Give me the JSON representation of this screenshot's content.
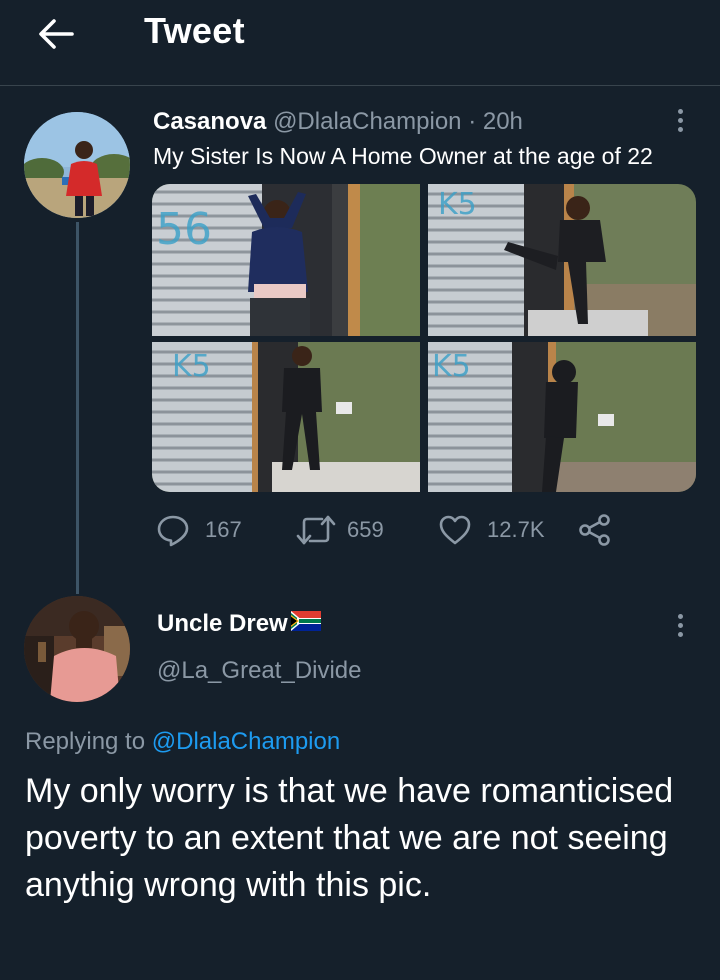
{
  "header": {
    "back_icon": "arrow-left-icon",
    "title": "Tweet"
  },
  "tweet": {
    "author_name": "Casanova",
    "author_handle": "@DlalaChampion",
    "separator": "·",
    "time": "20h",
    "text": "My Sister Is Now A Home Owner at the age of 22",
    "photo_count": 4,
    "actions": {
      "reply_icon": "speech-bubble-icon",
      "replies": "167",
      "retweet_icon": "retweet-icon",
      "retweets": "659",
      "like_icon": "heart-icon",
      "likes": "12.7K",
      "share_icon": "share-icon"
    },
    "more_icon": "more-vertical-icon"
  },
  "reply": {
    "author_name": "Uncle Drew",
    "author_flag_icon": "south-africa-flag-icon",
    "author_handle": "@La_Great_Divide",
    "replying_to_prefix": "Replying to",
    "replying_to_mention": "@DlalaChampion",
    "text": "My only worry is that we have romanticised poverty to an extent that we are not seeing anythig wrong with this pic.",
    "more_icon": "more-vertical-icon"
  },
  "colors": {
    "background": "#15202b",
    "text_primary": "#ffffff",
    "text_muted": "#8b98a5",
    "link": "#1d9bf0",
    "divider": "#38444d"
  }
}
